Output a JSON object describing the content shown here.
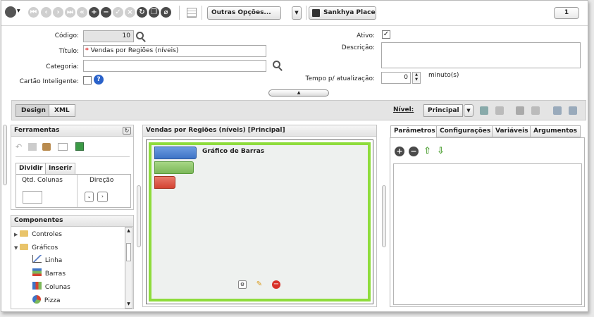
{
  "toolbar": {
    "more_options_label": "Outras Opções...",
    "place_label": "Sankhya Place",
    "page_number": "1"
  },
  "form": {
    "codigo_label": "Código:",
    "codigo_value": "10",
    "titulo_label": "Título:",
    "titulo_required": "*",
    "titulo_value": "Vendas por Regiões (níveis)",
    "categoria_label": "Categoria:",
    "categoria_value": "",
    "cartao_label": "Cartão Inteligente:",
    "ativo_label": "Ativo:",
    "ativo_checked": "✓",
    "descricao_label": "Descrição:",
    "tempo_label": "Tempo p/ atualização:",
    "tempo_value": "0",
    "tempo_unit": "minuto(s)"
  },
  "design_bar": {
    "design_label": "Design",
    "xml_label": "XML",
    "nivel_label": "Nível:",
    "nivel_value": "Principal"
  },
  "ferramentas": {
    "title": "Ferramentas",
    "tab_dividir": "Dividir",
    "tab_inserir": "Inserir",
    "qtd_colunas_label": "Qtd. Colunas",
    "direcao_label": "Direção"
  },
  "componentes": {
    "title": "Componentes",
    "items": [
      {
        "label": "Controles"
      },
      {
        "label": "Gráficos"
      },
      {
        "label": "Linha"
      },
      {
        "label": "Barras"
      },
      {
        "label": "Colunas"
      },
      {
        "label": "Pizza"
      }
    ]
  },
  "canvas": {
    "title": "Vendas por Regiões (níveis) [Principal]",
    "chart_label": "Gráfico de Barras"
  },
  "right_panel": {
    "tabs": [
      "Parâmetros",
      "Configurações",
      "Variáveis",
      "Argumentos"
    ]
  },
  "colors": {
    "canvas_border": "#8edc3c",
    "bar_blue": "#3e74c6",
    "bar_green": "#7cb85a",
    "bar_red": "#d44332"
  }
}
